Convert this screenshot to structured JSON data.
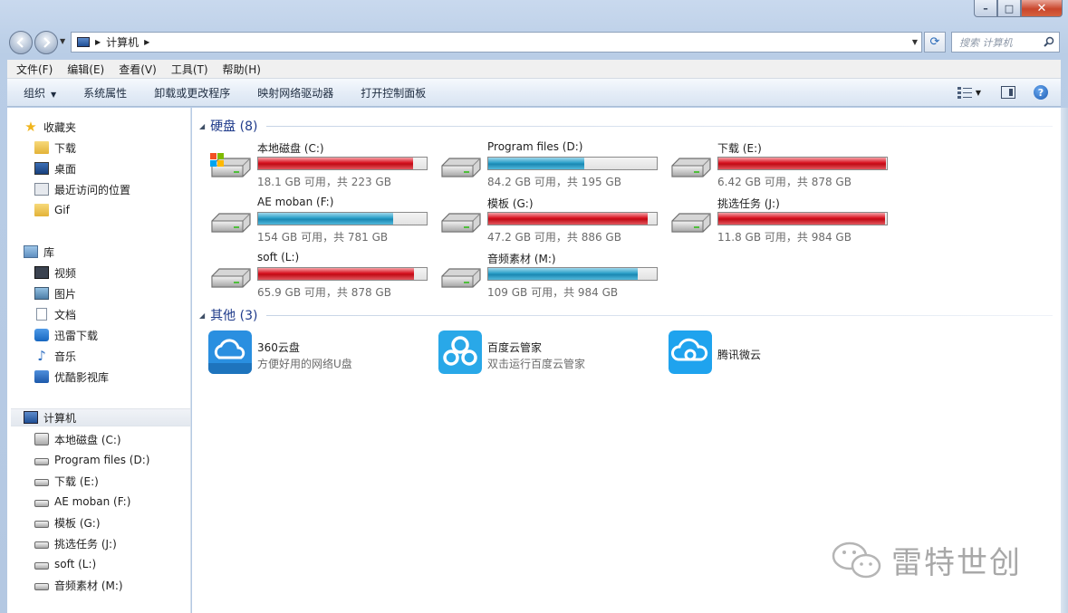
{
  "window": {
    "controls": {
      "minimize": "–",
      "maximize": "□",
      "close": "✕"
    }
  },
  "address": {
    "path": "计算机",
    "refresh_glyph": "⟳",
    "search_placeholder": "搜索 计算机"
  },
  "menu": {
    "items": [
      "文件(F)",
      "编辑(E)",
      "查看(V)",
      "工具(T)",
      "帮助(H)"
    ]
  },
  "command_bar": {
    "organize": "组织",
    "items": [
      "系统属性",
      "卸载或更改程序",
      "映射网络驱动器",
      "打开控制面板"
    ],
    "help": "?"
  },
  "nav": {
    "favorites": {
      "label": "收藏夹",
      "items": [
        "下载",
        "桌面",
        "最近访问的位置",
        "Gif"
      ]
    },
    "libraries": {
      "label": "库",
      "items": [
        "视频",
        "图片",
        "文档",
        "迅雷下载",
        "音乐",
        "优酷影视库"
      ]
    },
    "computer": {
      "label": "计算机",
      "items": [
        "本地磁盘 (C:)",
        "Program files (D:)",
        "下载 (E:)",
        "AE moban (F:)",
        "模板 (G:)",
        "挑选任务 (J:)",
        "soft (L:)",
        "音频素材 (M:)"
      ]
    }
  },
  "groups": {
    "drives_header": "硬盘 (8)",
    "others_header": "其他 (3)"
  },
  "drives": [
    {
      "name": "本地磁盘 (C:)",
      "free": "18.1 GB 可用，共 223 GB",
      "used_fraction": 0.919,
      "color": "#d7121f"
    },
    {
      "name": "Program files (D:)",
      "free": "84.2 GB 可用，共 195 GB",
      "used_fraction": 0.568,
      "color": "#2a9fc8"
    },
    {
      "name": "下载 (E:)",
      "free": "6.42 GB 可用，共 878 GB",
      "used_fraction": 0.993,
      "color": "#d7121f"
    },
    {
      "name": "AE moban (F:)",
      "free": "154 GB 可用，共 781 GB",
      "used_fraction": 0.803,
      "color": "#2a9fc8"
    },
    {
      "name": "模板 (G:)",
      "free": "47.2 GB 可用，共 886 GB",
      "used_fraction": 0.947,
      "color": "#d7121f"
    },
    {
      "name": "挑选任务 (J:)",
      "free": "11.8 GB 可用，共 984 GB",
      "used_fraction": 0.988,
      "color": "#d7121f"
    },
    {
      "name": "soft (L:)",
      "free": "65.9 GB 可用，共 878 GB",
      "used_fraction": 0.925,
      "color": "#d7121f"
    },
    {
      "name": "音频素材 (M:)",
      "free": "109 GB 可用，共 984 GB",
      "used_fraction": 0.889,
      "color": "#2a9fc8"
    }
  ],
  "others": [
    {
      "name": "360云盘",
      "desc": "方便好用的网络U盘"
    },
    {
      "name": "百度云管家",
      "desc": "双击运行百度云管家"
    },
    {
      "name": "腾讯微云",
      "desc": ""
    }
  ],
  "watermark": {
    "text": "雷特世创"
  },
  "colors": {
    "accent": "#1e3a8a",
    "full_bar": "#d7121f",
    "normal_bar": "#2a9fc8"
  }
}
